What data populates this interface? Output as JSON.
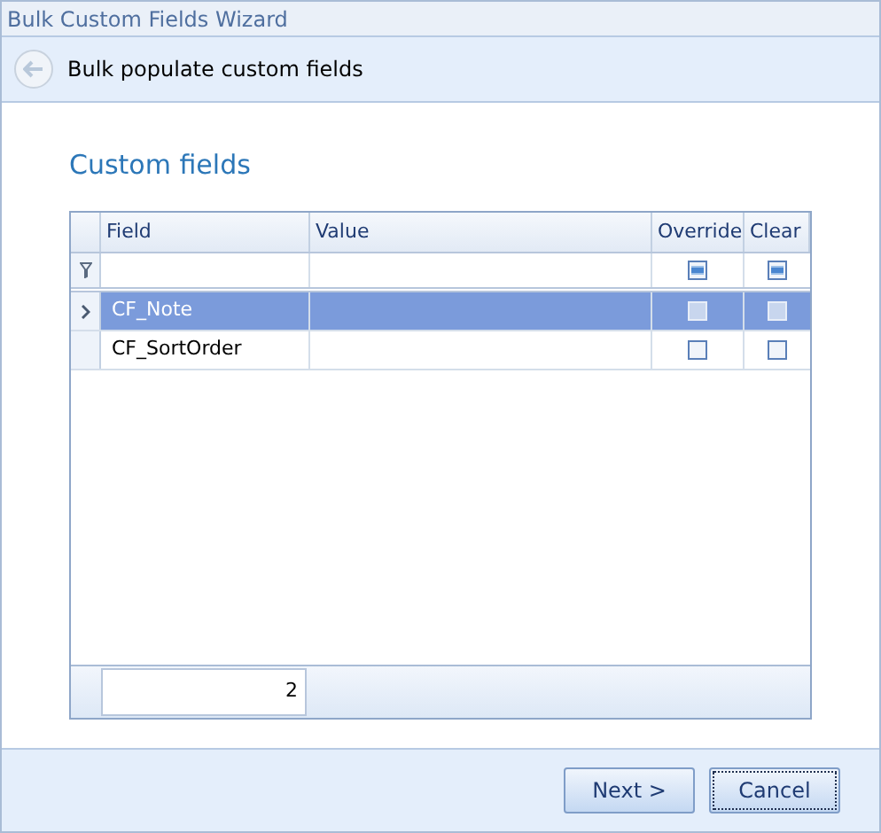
{
  "window": {
    "title": "Bulk Custom Fields Wizard"
  },
  "header": {
    "title": "Bulk populate custom fields"
  },
  "section_title": "Custom fields",
  "grid": {
    "columns": [
      "Field",
      "Value",
      "Override",
      "Clear"
    ],
    "filter_row": {
      "override": {
        "indeterminate": true
      },
      "clear": {
        "indeterminate": true
      }
    },
    "rows": [
      {
        "field": "CF_Note",
        "override": false,
        "clear": false,
        "selected": true
      },
      {
        "field": "CF_SortOrder",
        "override": false,
        "clear": false,
        "selected": false
      }
    ],
    "footer": {
      "count": "2"
    }
  },
  "buttons": [
    {
      "label": "Next >",
      "focused": false
    },
    {
      "label": "Cancel",
      "focused": true
    }
  ]
}
